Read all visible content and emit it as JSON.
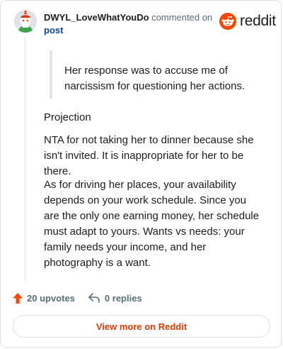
{
  "header": {
    "username": "DWYL_LoveWhatYouDo",
    "action_text": "commented on",
    "target_link": "post",
    "brand_name": "reddit"
  },
  "comment": {
    "quote": "Her response was to accuse me of narcissism for questioning her actions.",
    "paragraphs": [
      "Projection",
      "NTA for not taking her to dinner because she isn't invited. It is inappropriate for her to be there.",
      "As for driving her places, your availability depends on your work schedule. Since you are the only one earning money, her schedule must adapt to yours. Wants vs needs: your family needs your income, and her photography is a want."
    ]
  },
  "footer": {
    "upvotes": "20 upvotes",
    "replies": "0 replies",
    "view_more": "View more on Reddit"
  },
  "icons": {
    "avatar": "snoo-avatar",
    "brand": "reddit-logo-icon",
    "upvote": "upvote-arrow-icon",
    "reply": "reply-arrow-icon"
  },
  "colors": {
    "brand_orange": "#ff4500",
    "link_blue": "#0a449b",
    "muted_text": "#576f76",
    "view_more_text": "#d93a00",
    "border": "#dfe1e3"
  }
}
